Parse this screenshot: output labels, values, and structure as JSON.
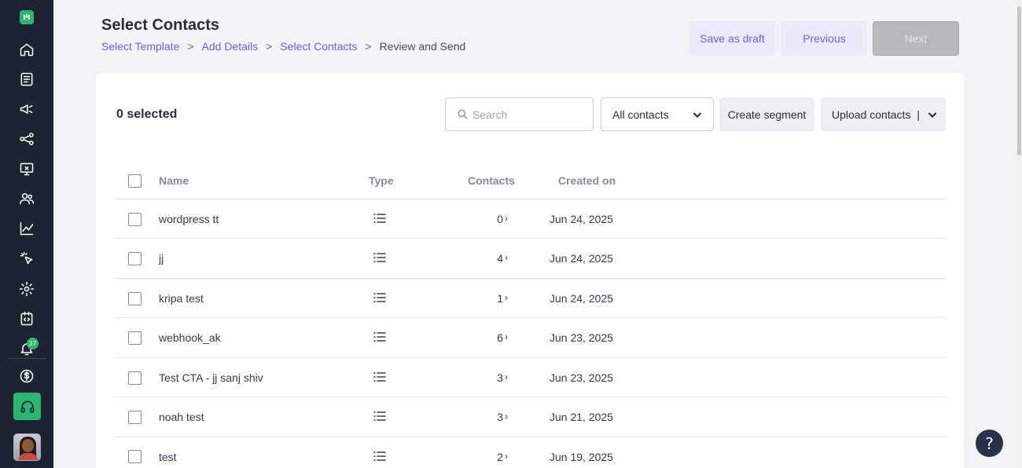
{
  "sidebar": {
    "items": [
      {
        "name": "home",
        "icon": "home-icon"
      },
      {
        "name": "templates",
        "icon": "document-icon"
      },
      {
        "name": "campaigns",
        "icon": "megaphone-icon"
      },
      {
        "name": "flows",
        "icon": "share-icon"
      },
      {
        "name": "inbox",
        "icon": "monitor-icon"
      },
      {
        "name": "contacts",
        "icon": "users-icon"
      },
      {
        "name": "analytics",
        "icon": "chart-icon"
      },
      {
        "name": "clicks",
        "icon": "cursor-click-icon"
      },
      {
        "name": "settings",
        "icon": "gear-icon"
      },
      {
        "name": "developer",
        "icon": "code-icon"
      },
      {
        "name": "notifications",
        "icon": "bell-icon"
      },
      {
        "name": "billing",
        "icon": "dollar-icon"
      }
    ],
    "notification_count": "37",
    "accent": "#2bb673"
  },
  "header": {
    "title": "Select Contacts",
    "breadcrumb": {
      "step1": "Select Template",
      "step2": "Add Details",
      "step3": "Select Contacts",
      "step4": "Review and Send",
      "separator": ">"
    },
    "save_draft_label": "Save as draft",
    "previous_label": "Previous",
    "next_label": "Next"
  },
  "toolbar": {
    "selected_count": "0 selected",
    "search_placeholder": "Search",
    "filter_value": "All contacts",
    "create_segment_label": "Create segment",
    "upload_label": "Upload contacts",
    "upload_separator": "|"
  },
  "table": {
    "columns": {
      "name": "Name",
      "type": "Type",
      "contacts": "Contacts",
      "created": "Created on"
    },
    "rows": [
      {
        "name": "wordpress tt",
        "contacts": "0",
        "created": "Jun 24, 2025"
      },
      {
        "name": "jj",
        "contacts": "4",
        "created": "Jun 24, 2025"
      },
      {
        "name": "kripa test",
        "contacts": "1",
        "created": "Jun 24, 2025"
      },
      {
        "name": "webhook_ak",
        "contacts": "6",
        "created": "Jun 23, 2025"
      },
      {
        "name": "Test CTA - jj sanj shiv",
        "contacts": "3",
        "created": "Jun 23, 2025"
      },
      {
        "name": "noah test",
        "contacts": "3",
        "created": "Jun 21, 2025"
      },
      {
        "name": "test",
        "contacts": "2",
        "created": "Jun 19, 2025"
      }
    ]
  },
  "help": {
    "label": "?"
  }
}
